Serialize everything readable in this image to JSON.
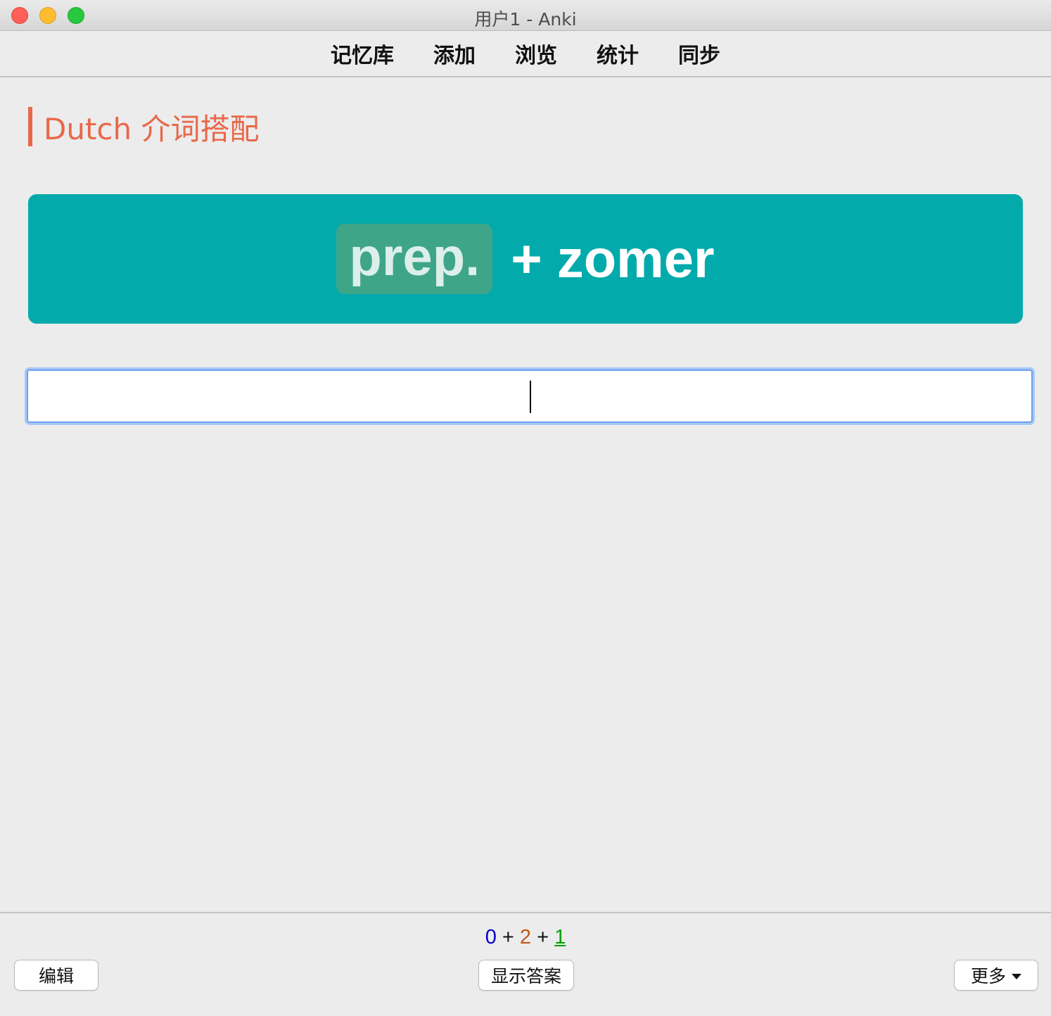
{
  "window": {
    "title": "用户1 - Anki"
  },
  "nav": {
    "items": [
      {
        "label": "记忆库"
      },
      {
        "label": "添加"
      },
      {
        "label": "浏览"
      },
      {
        "label": "统计"
      },
      {
        "label": "同步"
      }
    ]
  },
  "deck": {
    "title": "Dutch 介词搭配",
    "accent_color": "#e8684a"
  },
  "card": {
    "background_color": "#03aaac",
    "tag": "prep.",
    "front_text": "+ zomer"
  },
  "answer_input": {
    "value": ""
  },
  "counts": {
    "new": "0",
    "learning": "2",
    "review": "1",
    "separator": "+"
  },
  "buttons": {
    "edit": "编辑",
    "show_answer": "显示答案",
    "more": "更多"
  }
}
